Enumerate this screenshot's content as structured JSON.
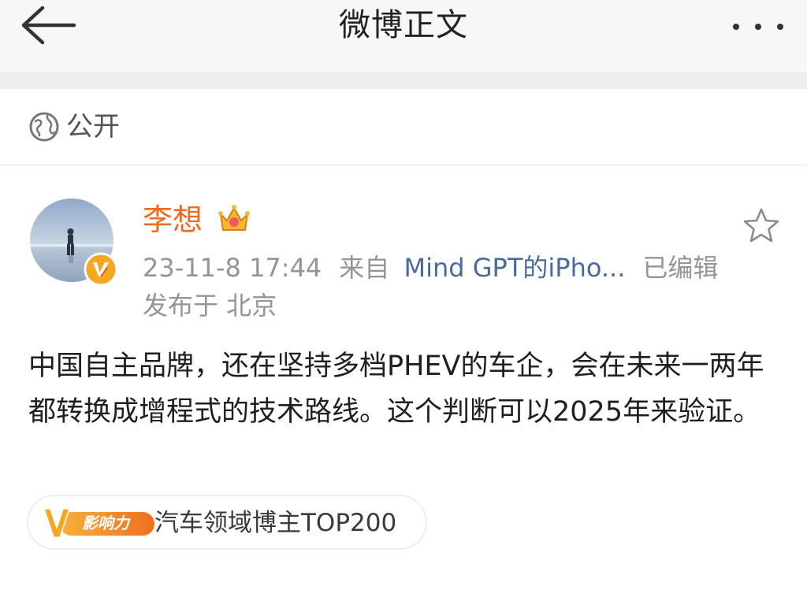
{
  "header": {
    "title": "微博正文",
    "back_icon": "arrow-left-icon",
    "more_icon": "more-dots-icon"
  },
  "visibility": {
    "icon": "globe-icon",
    "label": "公开"
  },
  "post": {
    "author": {
      "name": "李想",
      "avatar": "avatar",
      "verified_icon": "verified-v-icon",
      "member_icon": "crown-icon"
    },
    "timestamp": "23-11-8 17:44",
    "source_prefix": "来自",
    "source": "Mind GPT的iPho...",
    "edited": "已编辑",
    "location": "发布于 北京",
    "text": "中国自主品牌，还在坚持多档PHEV的车企，会在未来一两年都转换成增程式的技术路线。这个判断可以2025年来验证。",
    "favorite_icon": "star-outline-icon",
    "influence_tag": {
      "badge_text": "影响力",
      "label": "汽车领域博主TOP200"
    }
  },
  "colors": {
    "username": "#ef6a1f",
    "source_link": "#4a6a9e",
    "meta": "#959595",
    "badge_orange": "#f08a1c"
  }
}
